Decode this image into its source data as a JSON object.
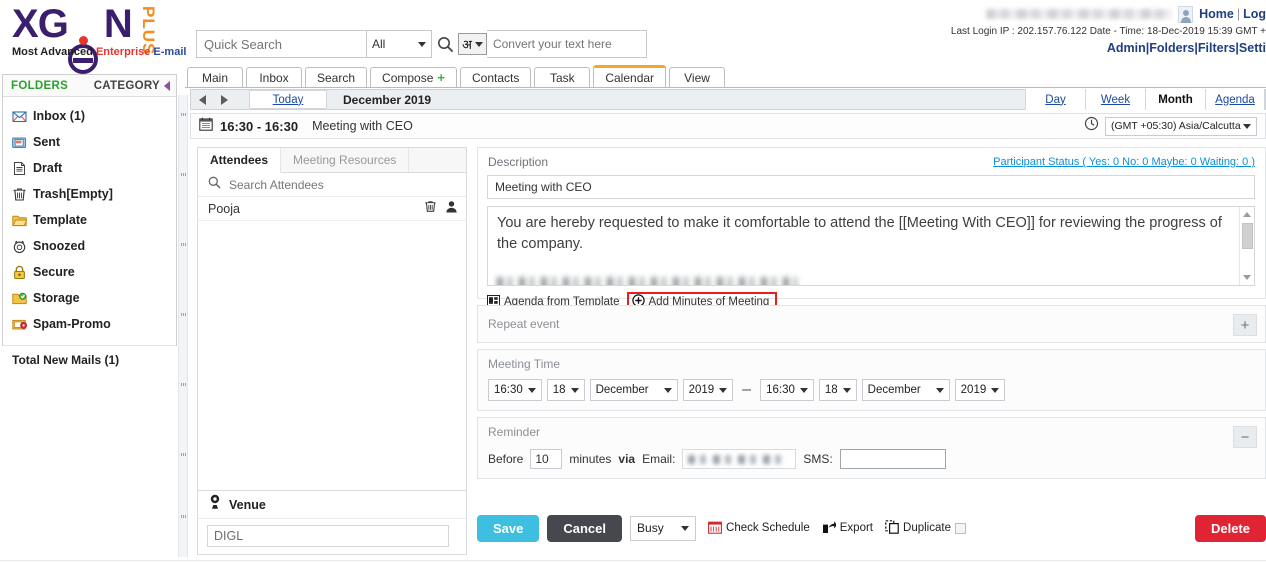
{
  "brand": {
    "name_part1": "X",
    "name_part2": "G",
    "name_part3": "N",
    "plus": "PLUS",
    "tagline_1": "Most Advanced ",
    "tagline_2": "Enterprise ",
    "tagline_3": "E-mail"
  },
  "search": {
    "placeholder": "Quick Search",
    "value": "",
    "scope_selected": "All",
    "search_icon": "search-icon",
    "lang_glyph": "अ",
    "convert_placeholder": "Convert your text here",
    "convert_value": ""
  },
  "header_right": {
    "account_email_masked": "",
    "home_label": "Home",
    "login_label": "Log",
    "last_login": "Last Login IP : 202.157.76.122 Date - Time: 18-Dec-2019 15:39 GMT +",
    "admin": "Admin",
    "folders": "Folders",
    "filters": "Filters",
    "settings": "Setti"
  },
  "tabs": [
    {
      "label": "Main",
      "active": false
    },
    {
      "label": "Inbox",
      "active": false
    },
    {
      "label": "Search",
      "active": false
    },
    {
      "label": "Compose",
      "active": false,
      "badge": "+"
    },
    {
      "label": "Contacts",
      "active": false
    },
    {
      "label": "Task",
      "active": false
    },
    {
      "label": "Calendar",
      "active": true
    },
    {
      "label": "View",
      "active": false
    }
  ],
  "sidebar": {
    "folders_label": "FOLDERS",
    "category_label": "CATEGORY",
    "items": [
      {
        "label": "Inbox (1)",
        "icon": "inbox-envelope-icon"
      },
      {
        "label": "Sent",
        "icon": "sent-folder-icon"
      },
      {
        "label": "Draft",
        "icon": "draft-page-icon"
      },
      {
        "label": "Trash[Empty]",
        "icon": "trash-icon"
      },
      {
        "label": "Template",
        "icon": "template-folder-icon"
      },
      {
        "label": "Snoozed",
        "icon": "alarm-clock-icon"
      },
      {
        "label": "Secure",
        "icon": "lock-icon"
      },
      {
        "label": "Storage",
        "icon": "storage-folder-icon"
      },
      {
        "label": "Spam-Promo",
        "icon": "spam-folder-icon"
      }
    ],
    "total_new": "Total New Mails (1)"
  },
  "calendar_toolbar": {
    "prev_icon": "chevron-left-icon",
    "next_icon": "chevron-right-icon",
    "today_label": "Today",
    "month_year": "December 2019",
    "views": [
      {
        "label": "Day",
        "selected": false
      },
      {
        "label": "Week",
        "selected": false
      },
      {
        "label": "Month",
        "selected": true
      },
      {
        "label": "Agenda",
        "selected": false
      }
    ]
  },
  "meeting_bar": {
    "calendar_icon": "calendar-icon",
    "time_range": "16:30 - 16:30",
    "title": "Meeting with CEO",
    "clock_icon": "clock-icon",
    "timezone": "(GMT +05:30) Asia/Calcutta"
  },
  "attendees_panel": {
    "tabs": [
      {
        "label": "Attendees",
        "selected": true
      },
      {
        "label": "Meeting Resources",
        "selected": false
      }
    ],
    "search_placeholder": "Search Attendees",
    "search_value": "",
    "rows": [
      {
        "name": "Pooja",
        "delete_icon": "trash-icon",
        "person_icon": "user-icon"
      }
    ]
  },
  "venue": {
    "icon": "location-pin-icon",
    "label": "Venue",
    "value": "DIGL"
  },
  "description": {
    "label": "Description",
    "participant_status": "Participant Status ( Yes: 0 No: 0 Maybe: 0 Waiting: 0 )",
    "subject_value": "Meeting with CEO",
    "body_text": "You are hereby requested to make it comfortable to attend the [[Meeting With CEO]] for reviewing the progress of the company.",
    "agenda_from_template": "Agenda from Template",
    "add_minutes_of_meeting": "Add Minutes of Meeting",
    "highlight_color": "#ee1b1b"
  },
  "repeat_event": {
    "label": "Repeat event",
    "toggle": "+"
  },
  "meeting_time": {
    "label": "Meeting Time",
    "start": {
      "time": "16:30",
      "day": "18",
      "month": "December",
      "year": "2019"
    },
    "separator": "–",
    "end": {
      "time": "16:30",
      "day": "18",
      "month": "December",
      "year": "2019"
    }
  },
  "reminder": {
    "label": "Reminder",
    "toggle": "−",
    "before_label": "Before",
    "minutes_value": "10",
    "minutes_label": "minutes",
    "via_label": "via",
    "email_label": "Email:",
    "email_value_masked": "",
    "sms_label": "SMS:",
    "sms_value": ""
  },
  "actions": {
    "save": "Save",
    "cancel": "Cancel",
    "status_selected": "Busy",
    "check_schedule": "Check Schedule",
    "export": "Export",
    "duplicate": "Duplicate",
    "delete": "Delete"
  },
  "colors": {
    "save": "#3ebfe0",
    "cancel": "#45484d",
    "delete": "#e02434",
    "link": "#1b4aa0",
    "status_link": "#0d8fd6",
    "active_tab_border": "#f5a623",
    "folders_green": "#2aa12a",
    "brand_purple": "#3b1e6e",
    "brand_orange": "#f68b1f"
  }
}
